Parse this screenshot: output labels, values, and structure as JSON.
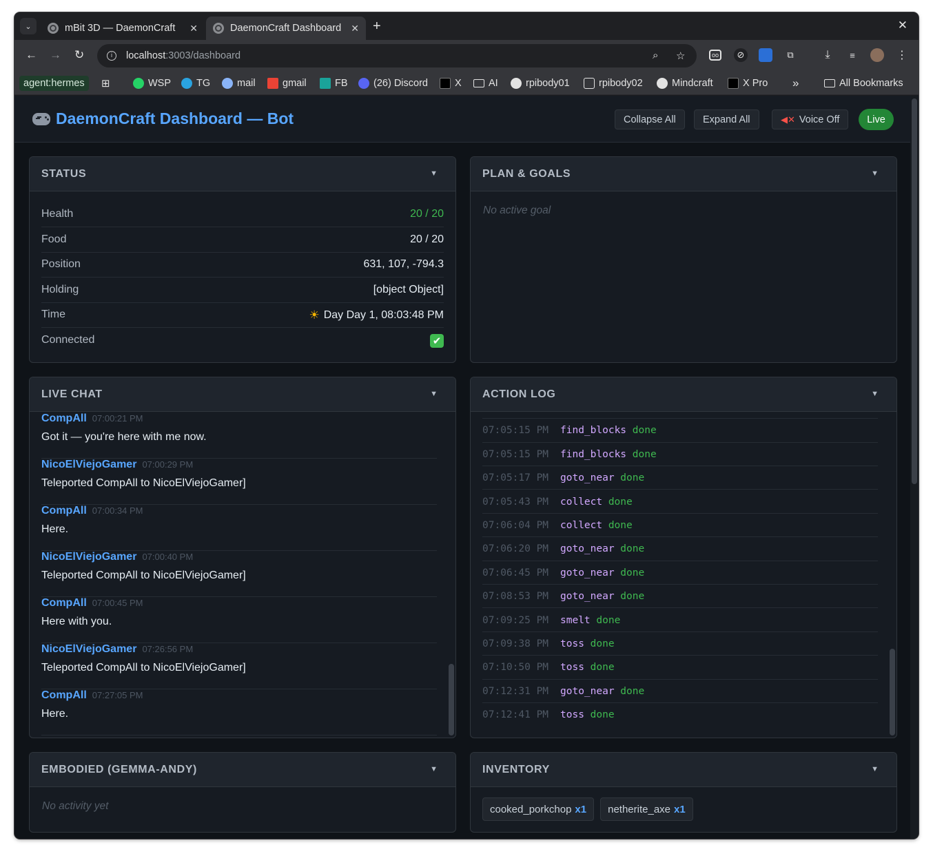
{
  "browser": {
    "tabs": [
      {
        "title": "mBit 3D — DaemonCraft",
        "active": false
      },
      {
        "title": "DaemonCraft Dashboard",
        "active": true
      }
    ],
    "url_host": "localhost",
    "url_path": ":3003/dashboard",
    "bookmarks": {
      "agent": "agent:hermes",
      "wsp": "WSP",
      "tg": "TG",
      "mail": "mail",
      "gmail": "gmail",
      "fb": "FB",
      "discord": "(26) Discord",
      "x": "X",
      "ai": "AI",
      "rpibody01": "rpibody01",
      "rpibody02": "rpibody02",
      "mindcraft": "Mindcraft",
      "xpro": "X Pro",
      "more": "»",
      "all": "All Bookmarks"
    }
  },
  "header": {
    "title": "DaemonCraft Dashboard — Bot",
    "collapse_all": "Collapse All",
    "expand_all": "Expand All",
    "voice": "Voice Off",
    "live": "Live"
  },
  "status": {
    "title": "STATUS",
    "rows": [
      {
        "key": "Health",
        "value": "20 / 20"
      },
      {
        "key": "Food",
        "value": "20 / 20"
      },
      {
        "key": "Position",
        "value": "631, 107, -794.3"
      },
      {
        "key": "Holding",
        "value": "[object Object]"
      },
      {
        "key": "Time",
        "value": "Day Day 1, 08:03:48 PM"
      },
      {
        "key": "Connected",
        "value": "✔"
      }
    ]
  },
  "plan": {
    "title": "PLAN & GOALS",
    "empty": "No active goal"
  },
  "chat": {
    "title": "LIVE CHAT",
    "messages": [
      {
        "user": "CompAll",
        "time": "07:00:21 PM",
        "text": "Got it — you're here with me now."
      },
      {
        "user": "NicoElViejoGamer",
        "time": "07:00:29 PM",
        "text": "Teleported CompAll to NicoElViejoGamer]"
      },
      {
        "user": "CompAll",
        "time": "07:00:34 PM",
        "text": "Here."
      },
      {
        "user": "NicoElViejoGamer",
        "time": "07:00:40 PM",
        "text": "Teleported CompAll to NicoElViejoGamer]"
      },
      {
        "user": "CompAll",
        "time": "07:00:45 PM",
        "text": "Here with you."
      },
      {
        "user": "NicoElViejoGamer",
        "time": "07:26:56 PM",
        "text": "Teleported CompAll to NicoElViejoGamer]"
      },
      {
        "user": "CompAll",
        "time": "07:27:05 PM",
        "text": "Here."
      }
    ]
  },
  "log": {
    "title": "ACTION LOG",
    "entries": [
      {
        "time": "07:05:15 PM",
        "action": "find_blocks",
        "status": "done"
      },
      {
        "time": "07:05:15 PM",
        "action": "find_blocks",
        "status": "done"
      },
      {
        "time": "07:05:17 PM",
        "action": "goto_near",
        "status": "done"
      },
      {
        "time": "07:05:43 PM",
        "action": "collect",
        "status": "done"
      },
      {
        "time": "07:06:04 PM",
        "action": "collect",
        "status": "done"
      },
      {
        "time": "07:06:20 PM",
        "action": "goto_near",
        "status": "done"
      },
      {
        "time": "07:06:45 PM",
        "action": "goto_near",
        "status": "done"
      },
      {
        "time": "07:08:53 PM",
        "action": "goto_near",
        "status": "done"
      },
      {
        "time": "07:09:25 PM",
        "action": "smelt",
        "status": "done"
      },
      {
        "time": "07:09:38 PM",
        "action": "toss",
        "status": "done"
      },
      {
        "time": "07:10:50 PM",
        "action": "toss",
        "status": "done"
      },
      {
        "time": "07:12:31 PM",
        "action": "goto_near",
        "status": "done"
      },
      {
        "time": "07:12:41 PM",
        "action": "toss",
        "status": "done"
      }
    ]
  },
  "embodied": {
    "title": "EMBODIED (GEMMA-ANDY)",
    "empty": "No activity yet"
  },
  "inventory": {
    "title": "INVENTORY",
    "items": [
      {
        "name": "cooked_porkchop",
        "count": "x1"
      },
      {
        "name": "netherite_axe",
        "count": "x1"
      }
    ]
  },
  "colors": {
    "accent": "#58a6ff",
    "good": "#3fb950",
    "action": "#d2a8ff",
    "live": "#238636"
  }
}
